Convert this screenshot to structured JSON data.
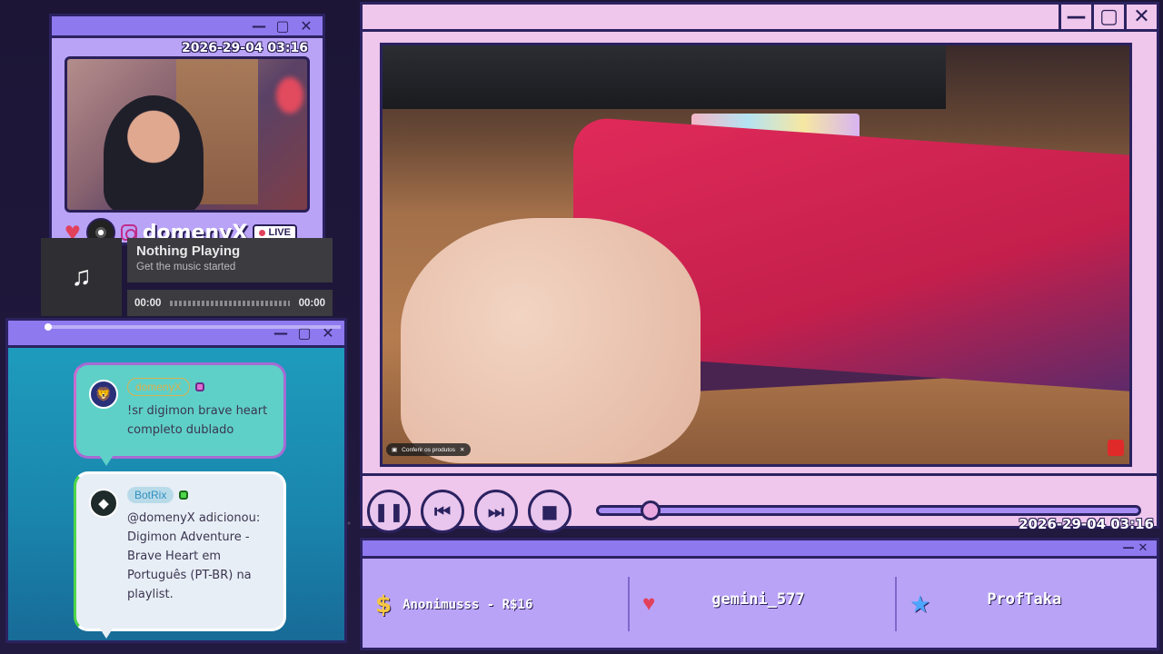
{
  "webcam_window": {
    "timestamp": "2026-29-04 03:16",
    "handle": "domenyX",
    "live_label": "LIVE",
    "titlebar_buttons": [
      "—",
      "▢",
      "✕"
    ]
  },
  "music_player": {
    "title": "Nothing Playing",
    "subtitle": "Get the music started",
    "time_current": "00:00",
    "time_total": "00:00",
    "icon": "music-note-icon"
  },
  "chat": {
    "titlebar_buttons": [
      "—",
      "▢",
      "✕"
    ],
    "messages": [
      {
        "username": "domenyX",
        "text": "!sr digimon brave heart completo dublado",
        "avatar_icon": "lion-avatar-icon",
        "accent": "#c96bcf"
      },
      {
        "username": "BotRix",
        "text": "@domenyX adicionou: Digimon Adventure - Brave Heart em Português (PT-BR) na playlist.",
        "avatar_icon": "bot-avatar-icon",
        "accent": "#4fd64a"
      }
    ]
  },
  "video_window": {
    "titlebar_buttons": [
      "—",
      "▢",
      "✕"
    ],
    "overlay_chip": "Conferir os produtos",
    "timestamp": "2026-29-04 03:16",
    "controls": [
      "pause",
      "previous",
      "next",
      "stop"
    ],
    "progress": 0.1
  },
  "alerts": {
    "titlebar_buttons": [
      "—",
      "✕"
    ],
    "last_donation": "Anonimusss - R$16",
    "last_follower": "gemini_577",
    "last_subscriber": "ProfTaka"
  },
  "colors": {
    "frame": "#2b2260",
    "purple": "#8e79ee",
    "pink": "#efc6ec",
    "lavender": "#b9a3f7"
  }
}
